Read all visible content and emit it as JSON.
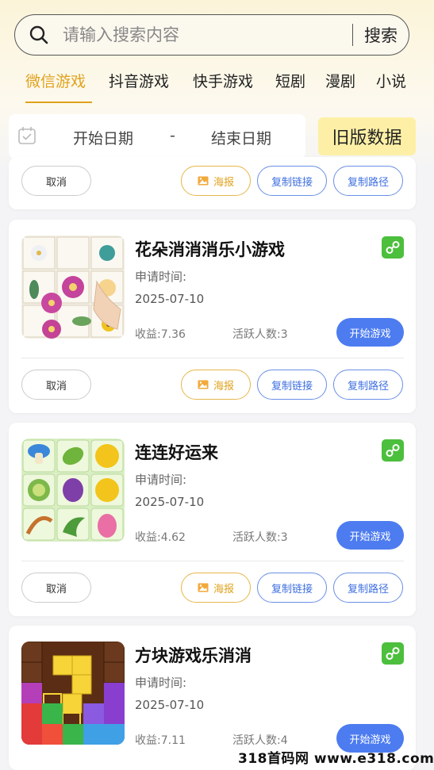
{
  "search": {
    "placeholder": "请输入搜索内容",
    "button": "搜索"
  },
  "tabs": [
    {
      "label": "微信游戏",
      "active": true
    },
    {
      "label": "抖音游戏"
    },
    {
      "label": "快手游戏"
    },
    {
      "label": "短剧"
    },
    {
      "label": "漫剧"
    },
    {
      "label": "小说"
    }
  ],
  "date_filter": {
    "start": "开始日期",
    "separator": "-",
    "end": "结束日期",
    "old_data": "旧版数据"
  },
  "actions": {
    "cancel": "取消",
    "poster": "海报",
    "copy_link": "复制链接",
    "copy_path": "复制路径",
    "start": "开始游戏"
  },
  "games": [
    {
      "title": "花朵消消消乐小游戏",
      "apply_label": "申请时间:",
      "apply_date": "2025-07-10",
      "income": "收益:7.36",
      "active_users": "活跃人数:3"
    },
    {
      "title": "连连好运来",
      "apply_label": "申请时间:",
      "apply_date": "2025-07-10",
      "income": "收益:4.62",
      "active_users": "活跃人数:3"
    },
    {
      "title": "方块游戏乐消消",
      "apply_label": "申请时间:",
      "apply_date": "2025-07-10",
      "income": "收益:7.11",
      "active_users": "活跃人数:4"
    }
  ],
  "colors": {
    "accent": "#e0a21d",
    "primary": "#4d7cf0",
    "link_green": "#4cbf3d"
  },
  "watermark": "318首码网 www.e318.com"
}
